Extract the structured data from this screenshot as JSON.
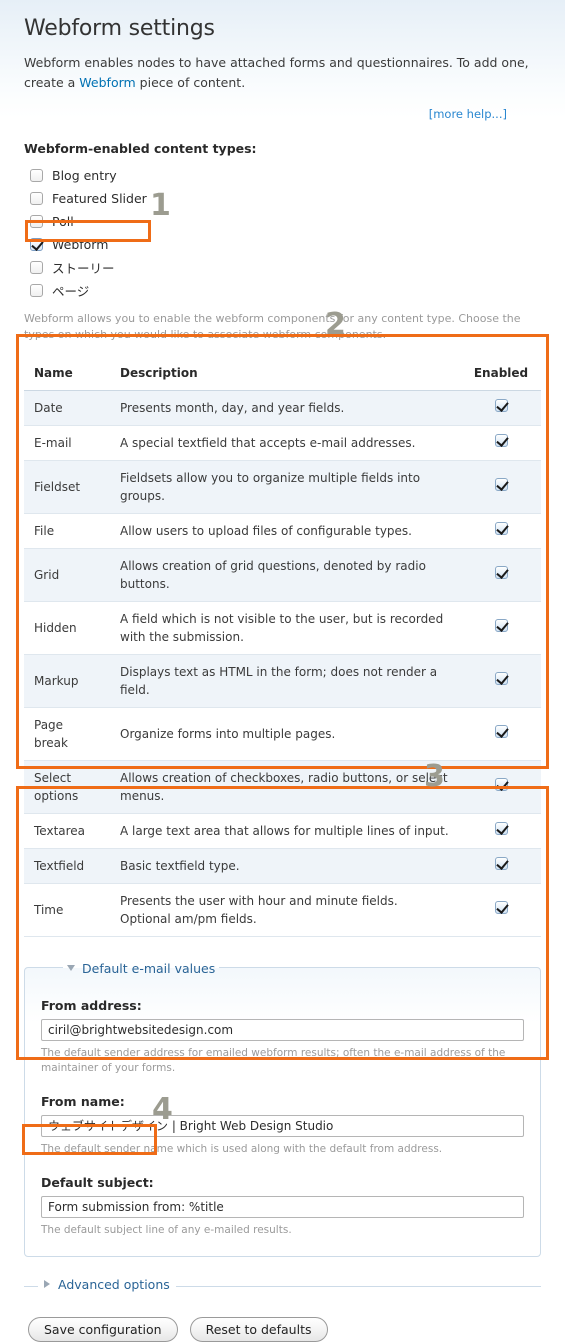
{
  "page": {
    "title": "Webform settings",
    "intro_before": "Webform enables nodes to have attached forms and questionnaires. To add one, create a ",
    "intro_link": "Webform",
    "intro_after": " piece of content.",
    "more_help": "more help..."
  },
  "content_types": {
    "label": "Webform-enabled content types:",
    "items": [
      {
        "label": "Blog entry",
        "checked": false
      },
      {
        "label": "Featured Slider",
        "checked": false
      },
      {
        "label": "Poll",
        "checked": false
      },
      {
        "label": "Webform",
        "checked": true
      },
      {
        "label": "ストーリー",
        "checked": false
      },
      {
        "label": "ページ",
        "checked": false
      }
    ],
    "hint": "Webform allows you to enable the webform components for any content type. Choose the types on which you would like to associate webform components."
  },
  "components_table": {
    "headers": [
      "Name",
      "Description",
      "Enabled"
    ],
    "rows": [
      {
        "name": "Date",
        "description": "Presents month, day, and year fields.",
        "enabled": true
      },
      {
        "name": "E-mail",
        "description": "A special textfield that accepts e-mail addresses.",
        "enabled": true
      },
      {
        "name": "Fieldset",
        "description": "Fieldsets allow you to organize multiple fields into groups.",
        "enabled": true
      },
      {
        "name": "File",
        "description": "Allow users to upload files of configurable types.",
        "enabled": true
      },
      {
        "name": "Grid",
        "description": "Allows creation of grid questions, denoted by radio buttons.",
        "enabled": true
      },
      {
        "name": "Hidden",
        "description": "A field which is not visible to the user, but is recorded with the submission.",
        "enabled": true
      },
      {
        "name": "Markup",
        "description": "Displays text as HTML in the form; does not render a field.",
        "enabled": true
      },
      {
        "name": "Page break",
        "description": "Organize forms into multiple pages.",
        "enabled": true
      },
      {
        "name": "Select options",
        "description": "Allows creation of checkboxes, radio buttons, or select menus.",
        "enabled": true
      },
      {
        "name": "Textarea",
        "description": "A large text area that allows for multiple lines of input.",
        "enabled": true
      },
      {
        "name": "Textfield",
        "description": "Basic textfield type.",
        "enabled": true
      },
      {
        "name": "Time",
        "description": "Presents the user with hour and minute fields. Optional am/pm fields.",
        "enabled": true
      }
    ]
  },
  "email_defaults": {
    "legend": "Default e-mail values",
    "from_address": {
      "label": "From address:",
      "value": "ciril@brightwebsitedesign.com",
      "hint": "The default sender address for emailed webform results; often the e-mail address of the maintainer of your forms."
    },
    "from_name": {
      "label": "From name:",
      "value": "ウェブサイトデザイン | Bright Web Design Studio",
      "hint": "The default sender name which is used along with the default from address."
    },
    "default_subject": {
      "label": "Default subject:",
      "value": "Form submission from: %title",
      "hint": "The default subject line of any e-mailed results."
    }
  },
  "advanced": {
    "legend": "Advanced options"
  },
  "buttons": {
    "save": "Save configuration",
    "reset": "Reset to defaults"
  },
  "annotations": {
    "accent_color": "#ef6c17",
    "number_color": "#9c9c90",
    "steps": [
      "1",
      "2",
      "3",
      "4"
    ]
  }
}
